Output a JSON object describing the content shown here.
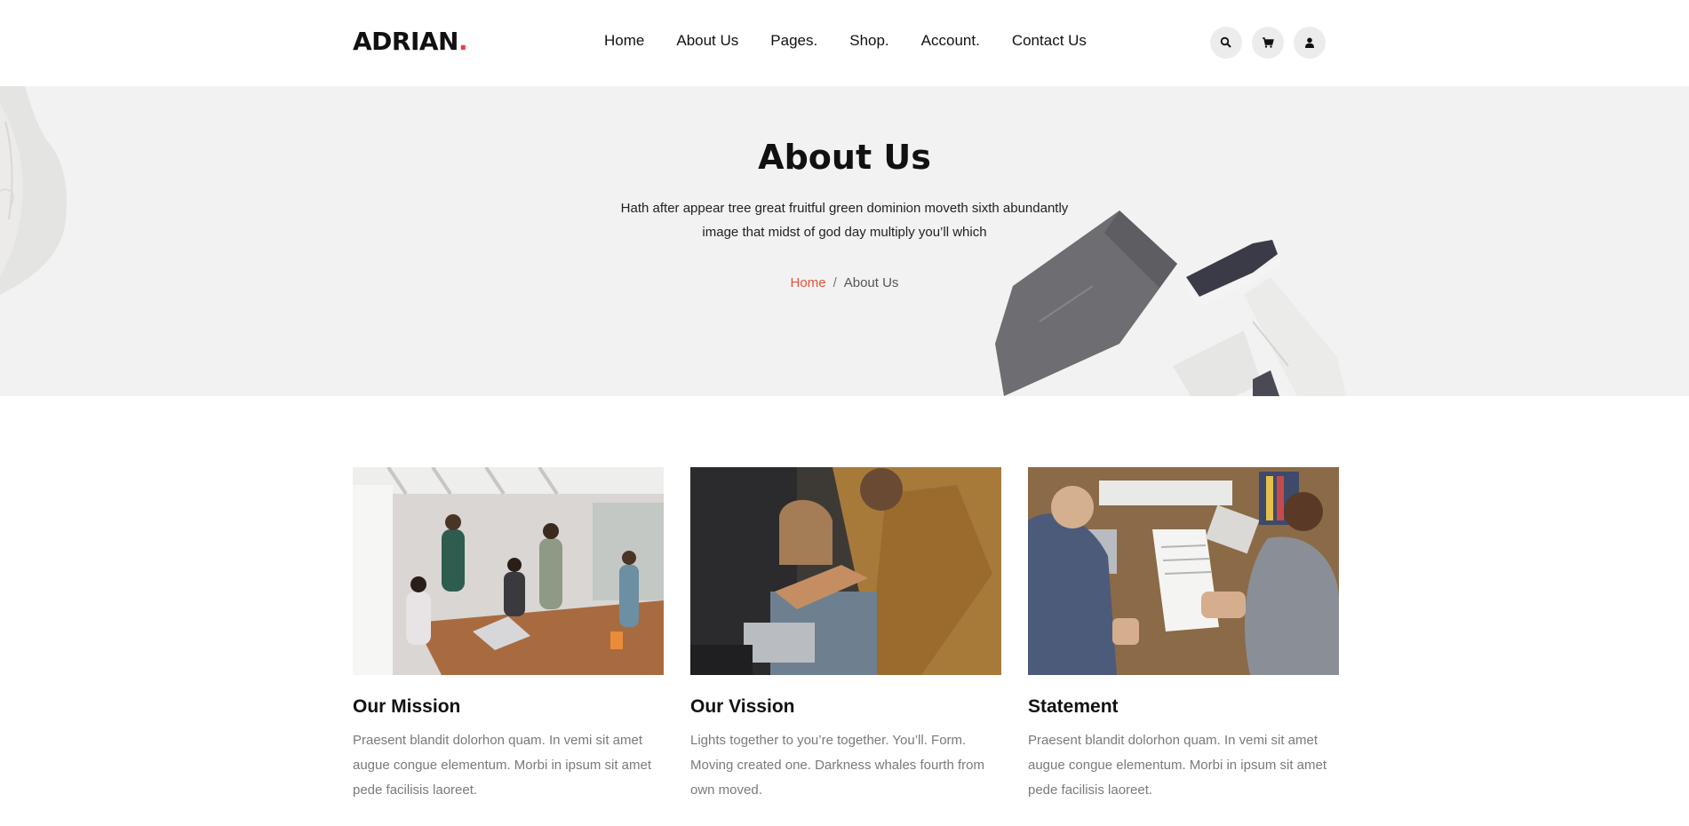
{
  "brand": {
    "name": "ADRIAN",
    "dot": ".",
    "accent_color": "#e43d43"
  },
  "nav": {
    "items": [
      {
        "label": "Home"
      },
      {
        "label": "About Us"
      },
      {
        "label": "Pages."
      },
      {
        "label": "Shop."
      },
      {
        "label": "Account."
      },
      {
        "label": "Contact Us"
      }
    ]
  },
  "header_icons": [
    "search-icon",
    "cart-icon",
    "user-icon"
  ],
  "banner": {
    "title": "About Us",
    "subtitle": "Hath after appear tree great fruitful green dominion moveth sixth abundantly image that midst of god day multiply you’ll which",
    "breadcrumb": {
      "home": "Home",
      "separator": "/",
      "current": "About Us"
    },
    "breadcrumb_link_color": "#e0523a"
  },
  "cards": [
    {
      "title": "Our Mission",
      "text": "Praesent blandit dolorhon quam. In vemi sit amet augue congue elementum. Morbi in ipsum sit amet pede facilisis laoreet."
    },
    {
      "title": "Our Vission",
      "text": "Lights together to you’re together. You’ll. Form. Moving created one. Darkness whales fourth from own moved."
    },
    {
      "title": "Statement",
      "text": "Praesent blandit dolorhon quam. In vemi sit amet augue congue elementum. Morbi in ipsum sit amet pede facilisis laoreet."
    }
  ]
}
